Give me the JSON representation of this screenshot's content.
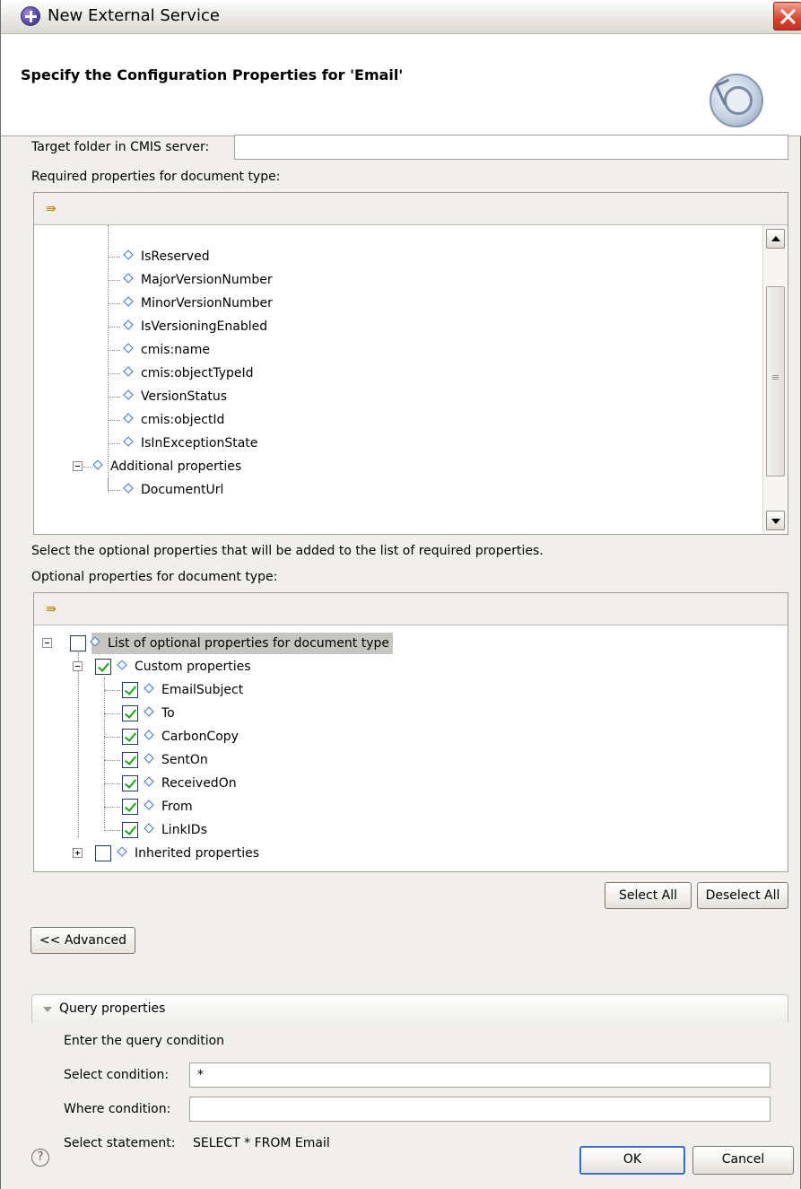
{
  "window": {
    "title": "New External Service"
  },
  "banner": {
    "title": "Specify the Configuration Properties for 'Email'"
  },
  "target_folder": {
    "label": "Target folder in CMIS server:",
    "value": ""
  },
  "required": {
    "label": "Required properties for document type:",
    "items": [
      "IsReserved",
      "MajorVersionNumber",
      "MinorVersionNumber",
      "IsVersioningEnabled",
      "cmis:name",
      "cmis:objectTypeId",
      "VersionStatus",
      "cmis:objectId",
      "IsInExceptionState"
    ],
    "additional_group": "Additional properties",
    "additional_items": [
      "DocumentUrl"
    ]
  },
  "optional": {
    "hint": "Select the optional properties that will be added to the list of required properties.",
    "label": "Optional properties for document type:",
    "root": "List of optional properties for document type",
    "custom_group": "Custom properties",
    "custom_items": [
      {
        "label": "EmailSubject",
        "checked": true
      },
      {
        "label": "To",
        "checked": true
      },
      {
        "label": "CarbonCopy",
        "checked": true
      },
      {
        "label": "SentOn",
        "checked": true
      },
      {
        "label": "ReceivedOn",
        "checked": true
      },
      {
        "label": "From",
        "checked": true
      },
      {
        "label": "LinkIDs",
        "checked": true
      }
    ],
    "inherited_group": "Inherited properties"
  },
  "buttons": {
    "select_all": "Select All",
    "deselect_all": "Deselect All",
    "advanced": "<< Advanced",
    "ok": "OK",
    "cancel": "Cancel"
  },
  "query": {
    "section_title": "Query properties",
    "intro": "Enter the query condition",
    "select_label": "Select condition:",
    "select_value": "*",
    "where_label": "Where condition:",
    "where_value": "",
    "statement_label": "Select statement:",
    "statement_value": "SELECT * FROM Email"
  },
  "icons": {
    "help": "?"
  }
}
